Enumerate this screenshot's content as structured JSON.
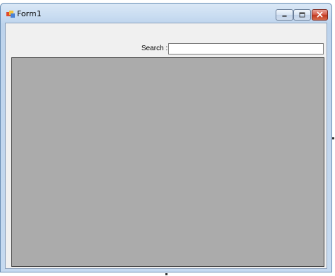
{
  "window": {
    "title": "Form1",
    "controls": {
      "minimize_icon": "minimize-icon",
      "maximize_icon": "maximize-icon",
      "close_icon": "close-icon"
    }
  },
  "search": {
    "label": "Search :",
    "value": "",
    "placeholder": ""
  },
  "grid": {
    "background_color": "#ababab"
  },
  "colors": {
    "close_button": "#c2391f",
    "client_background": "#f0f0f0",
    "titlebar": "#c9dcf1"
  }
}
